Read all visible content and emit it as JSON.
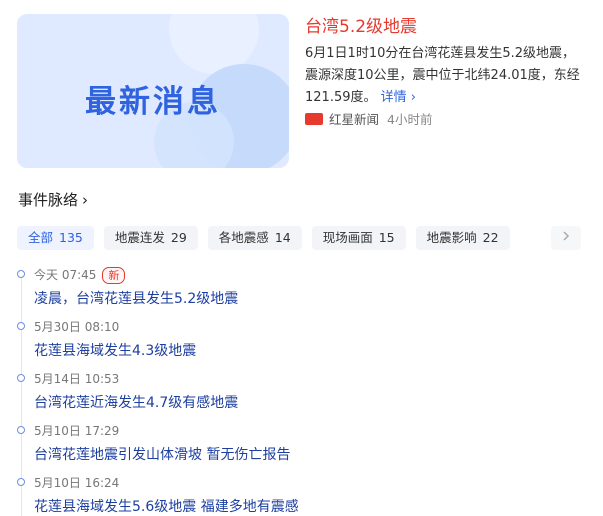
{
  "news_card": {
    "image_text": "最新消息",
    "headline": "台湾5.2级地震",
    "summary_lines": [
      "6月1日1时10分在台湾花莲县发生5.2级地震，",
      "震源深度10公里，震中位于北纬24.01度，东经",
      "121.59度。"
    ],
    "more_label": "详情 ›",
    "source": "红星新闻",
    "time": "4小时前"
  },
  "section": {
    "title": "事件脉络",
    "chevron": "›"
  },
  "tabs": [
    {
      "label": "全部",
      "count": "135",
      "active": true
    },
    {
      "label": "地震连发",
      "count": "29"
    },
    {
      "label": "各地震感",
      "count": "14"
    },
    {
      "label": "现场画面",
      "count": "15"
    },
    {
      "label": "地震影响",
      "count": "22"
    }
  ],
  "tab_next_icon": "chevron-right-icon",
  "timeline": [
    {
      "time": "今天 07:45",
      "badge": "新",
      "title": "凌晨，台湾花莲县发生5.2级地震"
    },
    {
      "time": "5月30日 08:10",
      "title": "花莲县海域发生4.3级地震"
    },
    {
      "time": "5月14日 10:53",
      "title": "台湾花莲近海发生4.7级有感地震"
    },
    {
      "time": "5月10日 17:29",
      "title": "台湾花莲地震引发山体滑坡 暂无伤亡报告"
    },
    {
      "time": "5月10日 16:24",
      "title": "花莲县海域发生5.6级地震 福建多地有震感"
    }
  ],
  "colors": {
    "accent": "#2f63e0",
    "headline": "#e63a2e",
    "link": "#1d3fa0"
  }
}
